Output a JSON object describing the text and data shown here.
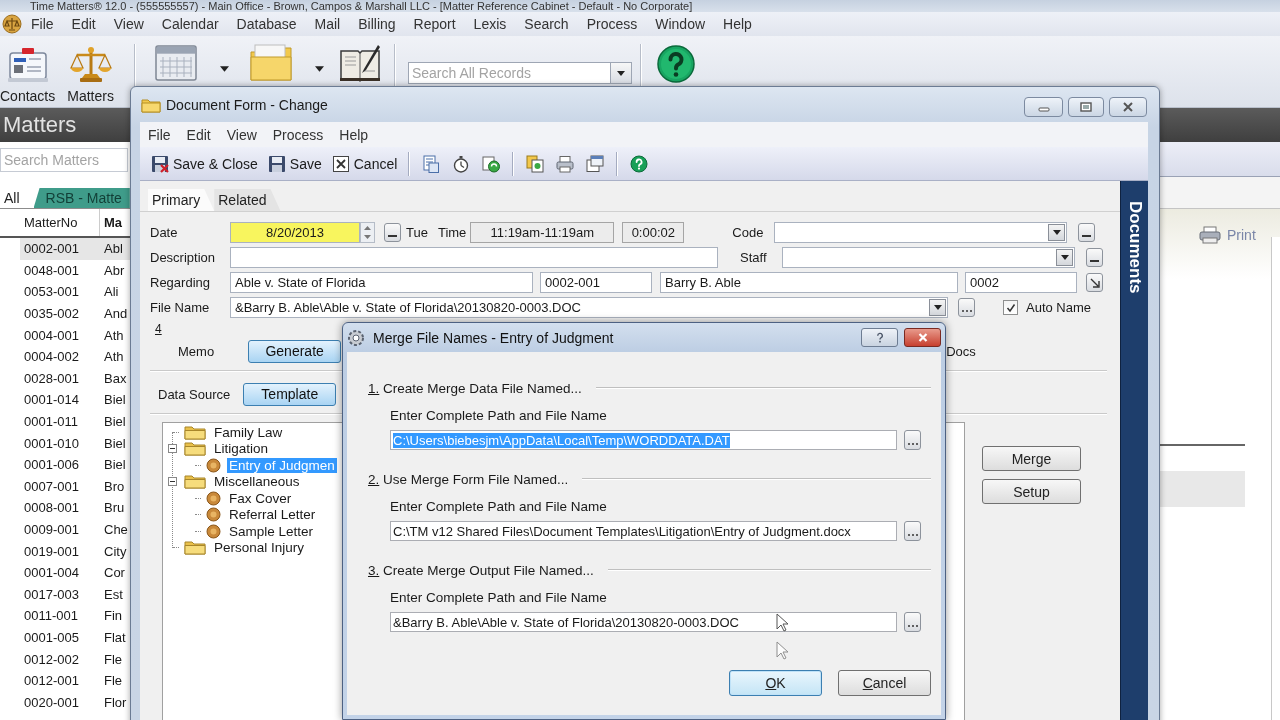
{
  "app_window": {
    "title": "Time Matters® 12.0 - (555555557) - Main Office - Brown, Campos & Marshall LLC - [Matter Reference Cabinet - Default - No Corporate]"
  },
  "menu_bar": [
    "File",
    "Edit",
    "View",
    "Calendar",
    "Database",
    "Mail",
    "Billing",
    "Report",
    "Lexis",
    "Search",
    "Process",
    "Window",
    "Help"
  ],
  "toolbar": {
    "items": [
      {
        "kind": "contacts",
        "label": "Contacts",
        "dropdown": false
      },
      {
        "kind": "matters",
        "label": "Matters",
        "dropdown": false
      },
      {
        "kind": "calendar",
        "dropdown": true
      },
      {
        "kind": "folder",
        "dropdown": true
      },
      {
        "kind": "notebook",
        "dropdown": false
      }
    ],
    "search": {
      "placeholder": "Search All Records"
    }
  },
  "matters_panel": {
    "title": "Matters",
    "search": {
      "placeholder": "Search Matters"
    },
    "tabs": [
      {
        "label": "All",
        "selected": true
      },
      {
        "label": "RSB - Matte",
        "selected": false
      }
    ],
    "table": {
      "columns": [
        "MatterNo",
        "Ma"
      ],
      "rows": [
        {
          "cells": [
            "0002-001",
            "Abl"
          ],
          "selected": true
        },
        {
          "cells": [
            "0048-001",
            "Abr"
          ],
          "selected": false
        },
        {
          "cells": [
            "0053-001",
            "Ali"
          ],
          "selected": false
        },
        {
          "cells": [
            "0035-002",
            "And"
          ],
          "selected": false
        },
        {
          "cells": [
            "0004-001",
            "Ath"
          ],
          "selected": false
        },
        {
          "cells": [
            "0004-002",
            "Ath"
          ],
          "selected": false
        },
        {
          "cells": [
            "0028-001",
            "Bax"
          ],
          "selected": false
        },
        {
          "cells": [
            "0001-014",
            "Biel"
          ],
          "selected": false
        },
        {
          "cells": [
            "0001-011",
            "Biel"
          ],
          "selected": false
        },
        {
          "cells": [
            "0001-010",
            "Biel"
          ],
          "selected": false
        },
        {
          "cells": [
            "0001-006",
            "Biel"
          ],
          "selected": false
        },
        {
          "cells": [
            "0007-001",
            "Bro"
          ],
          "selected": false
        },
        {
          "cells": [
            "0008-001",
            "Bru"
          ],
          "selected": false
        },
        {
          "cells": [
            "0009-001",
            "Che"
          ],
          "selected": false
        },
        {
          "cells": [
            "0019-001",
            "City"
          ],
          "selected": false
        },
        {
          "cells": [
            "0001-004",
            "Cor"
          ],
          "selected": false
        },
        {
          "cells": [
            "0017-003",
            "Est"
          ],
          "selected": false
        },
        {
          "cells": [
            "0011-001",
            "Fin"
          ],
          "selected": false
        },
        {
          "cells": [
            "0001-005",
            "Flat"
          ],
          "selected": false
        },
        {
          "cells": [
            "0012-002",
            "Fle"
          ],
          "selected": false
        },
        {
          "cells": [
            "0012-001",
            "Fle"
          ],
          "selected": false
        },
        {
          "cells": [
            "0020-001",
            "Flor"
          ],
          "selected": false
        }
      ]
    }
  },
  "side_panel": {
    "print_link": "Print"
  },
  "document_form": {
    "title": "Document Form - Change",
    "menu": [
      "File",
      "Edit",
      "View",
      "Process",
      "Help"
    ],
    "toolbar": [
      [
        {
          "kind": "save-close",
          "label": "Save & Close"
        },
        {
          "kind": "save",
          "label": "Save"
        },
        {
          "kind": "cancel",
          "label": "Cancel"
        }
      ],
      [
        {
          "kind": "notes"
        },
        {
          "kind": "timer"
        },
        {
          "kind": "sync"
        }
      ],
      [
        {
          "kind": "copy"
        },
        {
          "kind": "print"
        },
        {
          "kind": "export"
        }
      ],
      [
        {
          "kind": "help"
        }
      ]
    ],
    "tabs": [
      {
        "label": "Primary",
        "selected": true
      },
      {
        "label": "Related",
        "selected": false
      }
    ],
    "date": {
      "label": "Date",
      "value": "8/20/2013",
      "weekday": "Tue"
    },
    "time": {
      "label": "Time",
      "value": "11:19am-11:19am",
      "duration": "0:00:02"
    },
    "code": {
      "label": "Code"
    },
    "description": {
      "label": "Description"
    },
    "staff": {
      "label": "Staff"
    },
    "regarding": {
      "label": "Regarding",
      "values": [
        "Able v. State of Florida",
        "0002-001",
        "Barry B. Able",
        "0002"
      ]
    },
    "file_name": {
      "label": "File Name",
      "value": "&Barry B. Able\\Able v. State of Florida\\20130820-0003.DOC",
      "auto_name": {
        "label": "Auto Name",
        "checked": true
      }
    },
    "row_marker": "4",
    "memo": {
      "label": "Memo",
      "button": "Generate"
    },
    "docs_label": "Docs",
    "data_source": {
      "label": "Data Source",
      "button": "Template"
    },
    "template_tree": [
      {
        "label": "Family Law",
        "kind": "folder",
        "selected": false
      },
      {
        "label": "Litigation",
        "kind": "folder",
        "expanded": true,
        "selected": false,
        "children": [
          {
            "label": "Entry of Judgmen",
            "kind": "document",
            "selected": true
          }
        ]
      },
      {
        "label": "Miscellaneous",
        "kind": "folder",
        "expanded": true,
        "selected": false,
        "children": [
          {
            "label": "Fax Cover",
            "kind": "document",
            "selected": false
          },
          {
            "label": "Referral Letter",
            "kind": "document",
            "selected": false
          },
          {
            "label": "Sample Letter",
            "kind": "document",
            "selected": false
          }
        ]
      },
      {
        "label": "Personal Injury",
        "kind": "folder",
        "selected": false
      }
    ],
    "buttons": [
      "Merge",
      "Setup"
    ],
    "side_tab": "Documents"
  },
  "merge_dialog": {
    "title": "Merge File Names - Entry of Judgment",
    "sections": [
      {
        "heading": "1. Create Merge Data File Named...",
        "field_label": "Enter Complete Path and File Name",
        "value": "C:\\Users\\biebesjm\\AppData\\Local\\Temp\\WORDDATA.DAT",
        "selected": true
      },
      {
        "heading": "2. Use Merge Form File Named...",
        "field_label": "Enter Complete Path and File Name",
        "value": "C:\\TM v12 Shared Files\\Document Templates\\Litigation\\Entry of Judgment.docx",
        "selected": false
      },
      {
        "heading": "3. Create Merge Output File Named...",
        "field_label": "Enter Complete Path and File Name",
        "value": "&Barry B. Able\\Able v. State of Florida\\20130820-0003.DOC",
        "selected": false
      }
    ],
    "buttons": [
      {
        "label": "OK",
        "default": true
      },
      {
        "label": "Cancel",
        "default": false
      }
    ]
  }
}
